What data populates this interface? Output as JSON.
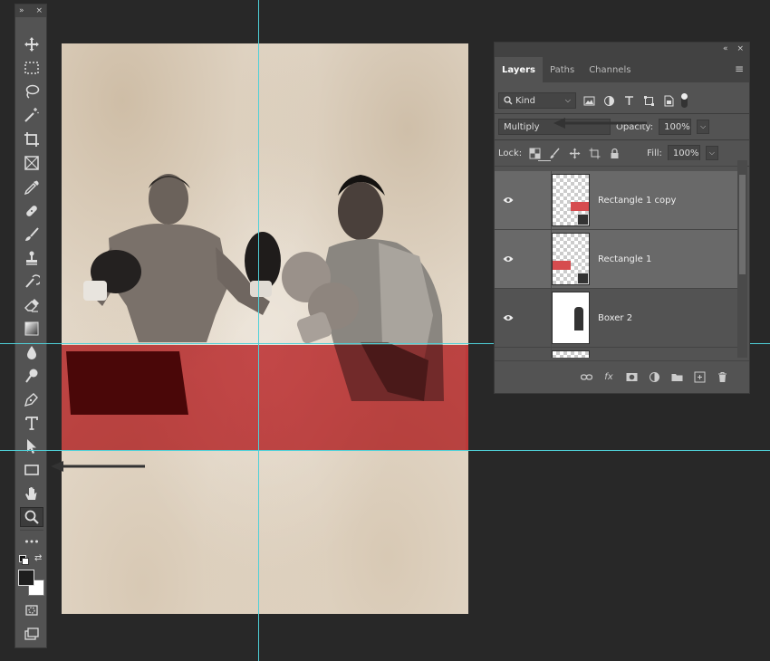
{
  "toolbar": {
    "collapse_label": "»",
    "close_label": "×",
    "tools": [
      {
        "icon": "move-icon"
      },
      {
        "icon": "marquee-icon"
      },
      {
        "icon": "lasso-icon"
      },
      {
        "icon": "magic-wand-icon"
      },
      {
        "icon": "crop-icon"
      },
      {
        "icon": "frame-icon"
      },
      {
        "icon": "eyedropper-icon"
      },
      {
        "icon": "healing-brush-icon"
      },
      {
        "icon": "brush-icon"
      },
      {
        "icon": "clone-stamp-icon"
      },
      {
        "icon": "history-brush-icon"
      },
      {
        "icon": "eraser-icon"
      },
      {
        "icon": "gradient-icon"
      },
      {
        "icon": "blur-icon"
      },
      {
        "icon": "dodge-icon"
      },
      {
        "icon": "pen-icon"
      },
      {
        "icon": "type-icon"
      },
      {
        "icon": "path-selection-icon"
      },
      {
        "icon": "rectangle-icon"
      },
      {
        "icon": "hand-icon"
      },
      {
        "icon": "zoom-icon",
        "active": true
      },
      {
        "icon": "more-tools-icon"
      }
    ],
    "foreground_color": "#1e1e1e",
    "background_color": "#ffffff"
  },
  "layers_panel": {
    "collapse_label": "«",
    "close_label": "×",
    "tabs": [
      {
        "label": "Layers",
        "active": true
      },
      {
        "label": "Paths",
        "active": false
      },
      {
        "label": "Channels",
        "active": false
      }
    ],
    "filter_kind": "Kind",
    "blend_mode": "Multiply",
    "opacity_label": "Opacity:",
    "opacity_value": "100%",
    "lock_label": "Lock:",
    "fill_label": "Fill:",
    "fill_value": "100%",
    "layers": [
      {
        "name": "Rectangle 1 copy",
        "selected": true,
        "visible": true
      },
      {
        "name": "Rectangle 1",
        "selected": true,
        "visible": true
      },
      {
        "name": "Boxer 2",
        "selected": false,
        "visible": true
      }
    ]
  },
  "colors": {
    "app_background": "#282828",
    "panel_bg": "#535353",
    "guide": "#4fd0d8",
    "red_rectangle": "#c8282d"
  }
}
